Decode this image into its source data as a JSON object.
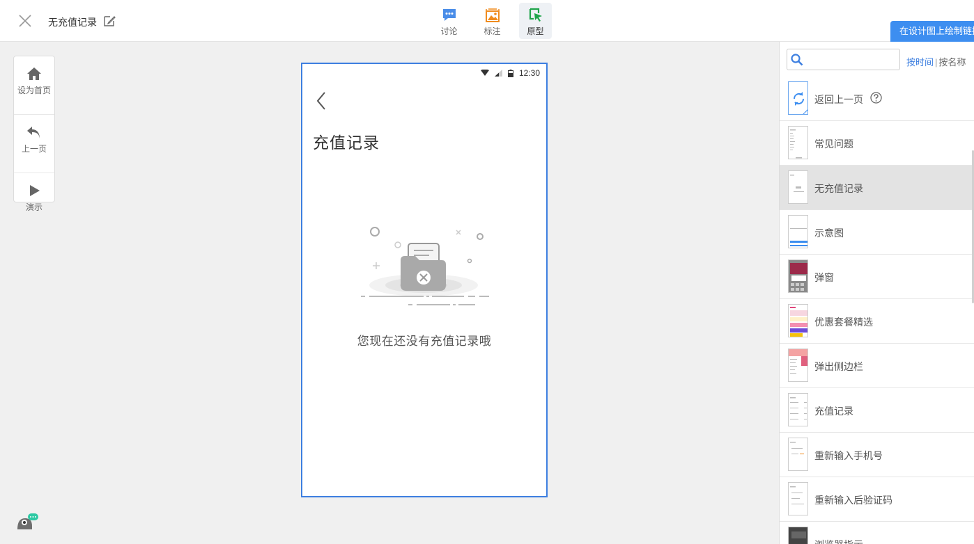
{
  "header": {
    "title": "无充值记录",
    "tabs": [
      {
        "label": "讨论",
        "icon": "chat-bubble-icon",
        "active": false
      },
      {
        "label": "标注",
        "icon": "annotation-image-icon",
        "active": false
      },
      {
        "label": "原型",
        "icon": "prototype-cursor-icon",
        "active": true
      }
    ],
    "link_button_label": "在设计图上绘制链接"
  },
  "tools": [
    {
      "label": "设为首页",
      "icon": "home-icon"
    },
    {
      "label": "上一页",
      "icon": "undo-arrow-icon"
    },
    {
      "label": "演示",
      "icon": "play-icon"
    }
  ],
  "phone": {
    "time": "12:30",
    "title": "充值记录",
    "empty_message": "您现在还没有充值记录哦"
  },
  "sidebar": {
    "search": {
      "value": "",
      "placeholder": ""
    },
    "sort_by_time": "按时间",
    "separator": "|",
    "sort_by_name": "按名称",
    "pages": [
      {
        "name": "返回上一页",
        "thumb": "return"
      },
      {
        "name": "常见问题",
        "thumb": "list"
      },
      {
        "name": "无充值记录",
        "thumb": "empty",
        "selected": true
      },
      {
        "name": "示意图",
        "thumb": "blue"
      },
      {
        "name": "弹窗",
        "thumb": "dark-red"
      },
      {
        "name": "优惠套餐精选",
        "thumb": "colorful"
      },
      {
        "name": "弹出侧边栏",
        "thumb": "pink-side"
      },
      {
        "name": "充值记录",
        "thumb": "list2"
      },
      {
        "name": "重新输入手机号",
        "thumb": "form"
      },
      {
        "name": "重新输入后验证码",
        "thumb": "form2"
      },
      {
        "name": "浏览器指示",
        "thumb": "dark"
      }
    ]
  },
  "colors": {
    "accent": "#3d7fe0",
    "button_blue": "#3d8ef0",
    "selected_row": "#e3e3e3"
  }
}
